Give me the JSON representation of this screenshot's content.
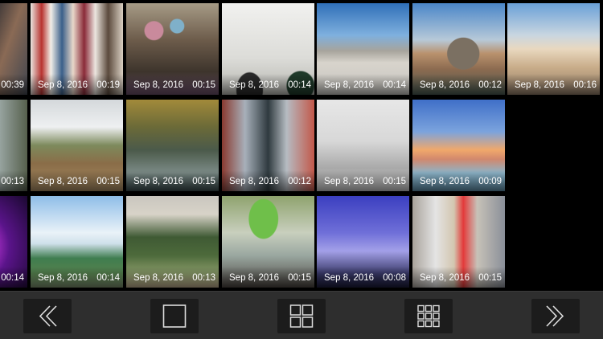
{
  "videos": [
    {
      "date": "",
      "duration": "00:39",
      "art": "clothes-left"
    },
    {
      "date": "Sep 8, 2016",
      "duration": "00:19",
      "art": "clothes-rack"
    },
    {
      "date": "Sep 8, 2016",
      "duration": "00:15",
      "art": "market-stall"
    },
    {
      "date": "Sep 8, 2016",
      "duration": "00:14",
      "art": "white-wall-shadows"
    },
    {
      "date": "Sep 8, 2016",
      "duration": "00:14",
      "art": "city-plaza"
    },
    {
      "date": "Sep 8, 2016",
      "duration": "00:12",
      "art": "rialto-bridge"
    },
    {
      "date": "Sep 8, 2016",
      "duration": "00:16",
      "art": "venice-palace"
    },
    {
      "date": "",
      "duration": "00:13",
      "art": "waterfall"
    },
    {
      "date": "Sep 8, 2016",
      "duration": "00:15",
      "art": "countryside-fence"
    },
    {
      "date": "Sep 8, 2016",
      "duration": "00:15",
      "art": "river-water"
    },
    {
      "date": "Sep 8, 2016",
      "duration": "00:12",
      "art": "city-street-aerial"
    },
    {
      "date": "Sep 8, 2016",
      "duration": "00:15",
      "art": "keyboard-blur"
    },
    {
      "date": "Sep 8, 2016",
      "duration": "00:09",
      "art": "beach-sunset"
    },
    {
      "date": "",
      "duration": "00:14",
      "art": "concert-lights"
    },
    {
      "date": "Sep 8, 2016",
      "duration": "00:14",
      "art": "sky-field"
    },
    {
      "date": "Sep 8, 2016",
      "duration": "00:13",
      "art": "park-trees"
    },
    {
      "date": "Sep 8, 2016",
      "duration": "00:15",
      "art": "drink-glass"
    },
    {
      "date": "Sep 8, 2016",
      "duration": "00:08",
      "art": "tower-bridge"
    },
    {
      "date": "Sep 8, 2016",
      "duration": "00:15",
      "art": "times-square"
    }
  ],
  "toolbar": {
    "buttons": [
      {
        "name": "previous-button",
        "icon": "double-chevron-left-icon"
      },
      {
        "name": "single-view-button",
        "icon": "square-icon"
      },
      {
        "name": "grid-2x2-button",
        "icon": "grid-2x2-icon"
      },
      {
        "name": "grid-3x3-button",
        "icon": "grid-3x3-icon"
      },
      {
        "name": "next-button",
        "icon": "double-chevron-right-icon"
      }
    ]
  },
  "colors": {
    "background": "#000000",
    "toolbar": "#2e2e2e",
    "toolbar_button": "#1c1c1c",
    "text": "#ffffff"
  }
}
